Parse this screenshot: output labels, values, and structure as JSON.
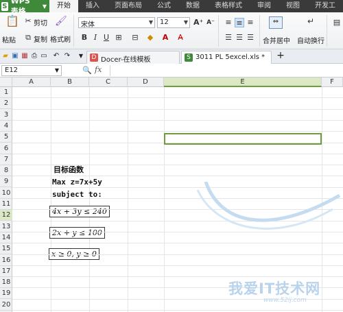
{
  "app": {
    "name": "WPS 表格",
    "logo": "S"
  },
  "menu_tabs": [
    "开始",
    "插入",
    "页面布局",
    "公式",
    "数据",
    "表格样式",
    "审阅",
    "视图",
    "开发工"
  ],
  "active_menu_tab": "开始",
  "ribbon": {
    "paste": "粘贴",
    "cut": "剪切",
    "copy": "复制",
    "format_painter": "格式刷",
    "font_name": "宋体",
    "font_size": "12",
    "bold": "B",
    "italic": "I",
    "underline": "U",
    "merge_center": "合并居中",
    "wrap_text": "自动换行"
  },
  "doc_tabs": [
    {
      "label": "Docer-在线模板",
      "active": false
    },
    {
      "label": "3011 PL 5excel.xls *",
      "active": true
    }
  ],
  "formula_bar": {
    "name_box": "E12",
    "fx_label": "fx",
    "value": ""
  },
  "columns": [
    "A",
    "B",
    "C",
    "D",
    "E",
    "F"
  ],
  "selected_column": "E",
  "rows": [
    "1",
    "2",
    "3",
    "4",
    "5",
    "6",
    "7",
    "8",
    "9",
    "10",
    "11",
    "12",
    "13",
    "14",
    "15",
    "16",
    "17",
    "18",
    "19",
    "20",
    "21"
  ],
  "selected_row": "12",
  "cells": {
    "b8": "目标函数",
    "b9": "Max z=7x+5y",
    "b10": "subject to:",
    "eq1": "4x + 3y ≤ 240",
    "eq2": "2x + y ≤ 100",
    "eq3": "x ≥ 0, y ≥ 0"
  },
  "watermark": {
    "text": "我爱IT技术网",
    "url": "www.52ij.com"
  },
  "colors": {
    "app_green": "#3e8a3a",
    "selection": "#6d9c3a"
  }
}
